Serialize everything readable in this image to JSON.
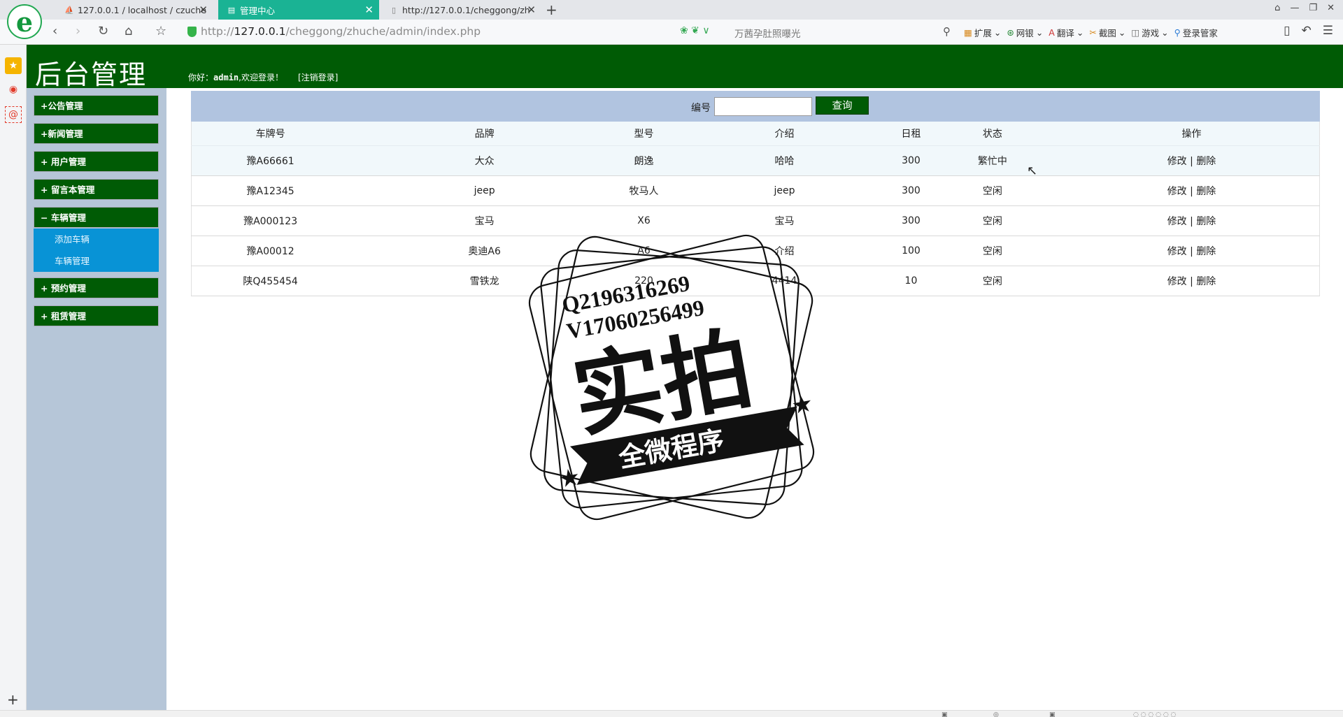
{
  "browser": {
    "tabs": [
      {
        "label": "127.0.0.1 / localhost / czuche",
        "active": false
      },
      {
        "label": "管理中心",
        "active": true
      },
      {
        "label": "http://127.0.0.1/cheggong/zh",
        "active": false
      }
    ],
    "url_prefix": "http://",
    "url_host": "127.0.0.1",
    "url_path": "/cheggong/zhuche/admin/index.php",
    "search_placeholder": "万茜孕肚照曝光",
    "toolbar": [
      "扩展",
      "网银",
      "翻译",
      "截图",
      "游戏",
      "登录管家"
    ],
    "accent_color": "#1ab394"
  },
  "header": {
    "title": "后台管理",
    "welcome_prefix": "你好：",
    "username": "admin",
    "welcome_suffix": ",欢迎登录！",
    "logout": "[注销登录]",
    "color": "#005b05"
  },
  "sidebar": {
    "menus": [
      {
        "label": "+公告管理"
      },
      {
        "label": "+新闻管理"
      },
      {
        "label": "+ 用户管理"
      },
      {
        "label": "+ 留言本管理"
      },
      {
        "label": "− 车辆管理",
        "expanded": true,
        "items": [
          "添加车辆",
          "车辆管理"
        ]
      },
      {
        "label": "+ 预约管理"
      },
      {
        "label": "+ 租赁管理"
      }
    ]
  },
  "search": {
    "label": "编号",
    "value": "",
    "button": "查询"
  },
  "table": {
    "headers": [
      "车牌号",
      "品牌",
      "型号",
      "介绍",
      "日租",
      "状态",
      "操作"
    ],
    "rows": [
      [
        "豫A66661",
        "大众",
        "朗逸",
        "哈哈",
        "300",
        "繁忙中"
      ],
      [
        "豫A12345",
        "jeep",
        "牧马人",
        "jeep",
        "300",
        "空闲"
      ],
      [
        "豫A000123",
        "宝马",
        "X6",
        "宝马",
        "300",
        "空闲"
      ],
      [
        "豫A00012",
        "奥迪A6",
        "A6",
        "介绍",
        "100",
        "空闲"
      ],
      [
        "陕Q455454",
        "雪铁龙",
        "220",
        "4414",
        "10",
        "空闲"
      ]
    ],
    "edit_label": "修改",
    "separator": "|",
    "delete_label": "删除"
  },
  "watermark": {
    "line1": "Q2196316269",
    "line2": "V17060256499",
    "main": "实拍",
    "banner": "全微程序"
  }
}
